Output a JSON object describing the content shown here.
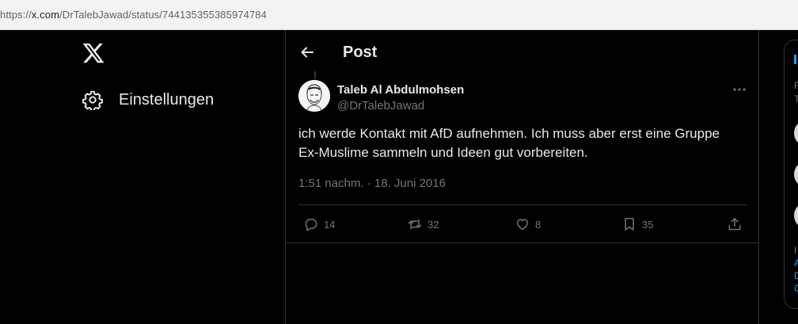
{
  "browser": {
    "url_prefix": "https://",
    "url_host": "x.com",
    "url_path": "/DrTalebJawad/status/744135355385974784"
  },
  "nav": {
    "logo_icon": "x-logo-icon",
    "settings_label": "Einstellungen",
    "settings_icon": "gear-icon"
  },
  "header": {
    "title": "Post",
    "back_icon": "arrow-left-icon"
  },
  "tweet": {
    "author_name": "Taleb Al Abdulmohsen",
    "author_handle": "@DrTalebJawad",
    "text_line1": "ich werde Kontakt mit AfD aufnehmen. Ich muss aber erst eine Gruppe",
    "text_line2": "Ex-Muslime sammeln und Ideen gut vorbereiten.",
    "timestamp": "1:51 nachm. · 18. Juni 2016",
    "replies": "14",
    "reposts": "32",
    "likes": "8",
    "bookmarks": "35"
  },
  "right_panel": {
    "letters": [
      "R",
      "T"
    ],
    "link_letters": [
      "A",
      "D",
      "C"
    ],
    "text_letter": "I"
  },
  "colors": {
    "background": "#000000",
    "text_primary": "#e7e9ea",
    "text_secondary": "#71767b",
    "border": "#2f3336",
    "accent": "#1d9bf0"
  }
}
